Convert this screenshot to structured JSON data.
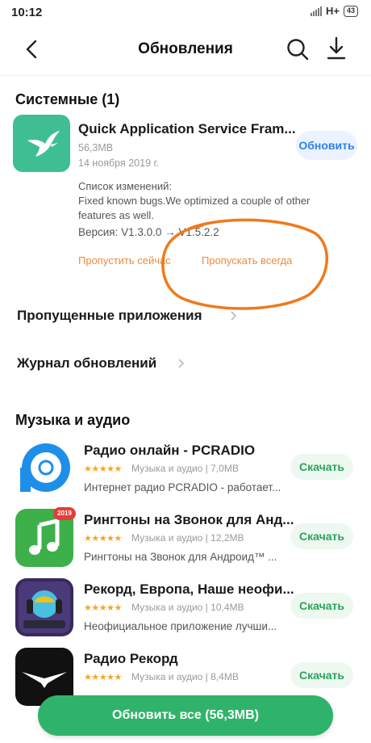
{
  "status_bar": {
    "time": "10:12",
    "network": "H+",
    "battery": "43"
  },
  "header": {
    "title": "Обновления"
  },
  "system_section": {
    "title": "Системные (1)",
    "app": {
      "name": "Quick Application Service Fram...",
      "size": "56,3MB",
      "date": "14 ноября 2019 г.",
      "update_label": "Обновить",
      "changelog_title": "Список изменений:",
      "changelog_text": "Fixed known bugs.We optimized a couple of other features as well.",
      "version": "Версия: V1.3.0.0 → V1.5.2.2",
      "skip_now": "Пропустить сейчас",
      "skip_always": "Пропускать всегда"
    }
  },
  "links": {
    "skipped": "Пропущенные приложения",
    "journal": "Журнал обновлений"
  },
  "music_section": {
    "title": "Музыка и аудио",
    "apps": [
      {
        "name": "Радио онлайн - PCRADIO",
        "rating": "★★★★★",
        "category": "Музыка и аудио",
        "size": "7,0MB",
        "description": "Интернет радио PCRADIO - работает...",
        "action": "Скачать"
      },
      {
        "name": "Рингтоны на Звонок для Анд...",
        "rating": "★★★★★",
        "category": "Музыка и аудио",
        "size": "12,2MB",
        "description": "Рингтоны на Звонок для Андроид™ ...",
        "action": "Скачать",
        "badge": "2019"
      },
      {
        "name": "Рекорд, Европа, Наше неофи...",
        "rating": "★★★★★",
        "category": "Музыка и аудио",
        "size": "10,4MB",
        "description": "Неофициальное приложение лучши...",
        "action": "Скачать"
      },
      {
        "name": "Радио Рекорд",
        "rating": "★★★★★",
        "category": "Музыка и аудио",
        "size": "8,4MB",
        "description": "",
        "action": "Скачать"
      }
    ]
  },
  "bottom_button": "Обновить все (56,3MB)",
  "colors": {
    "accent_blue": "#2f82e8",
    "accent_green": "#2fb36a",
    "annotation_orange": "#f07a1a"
  }
}
